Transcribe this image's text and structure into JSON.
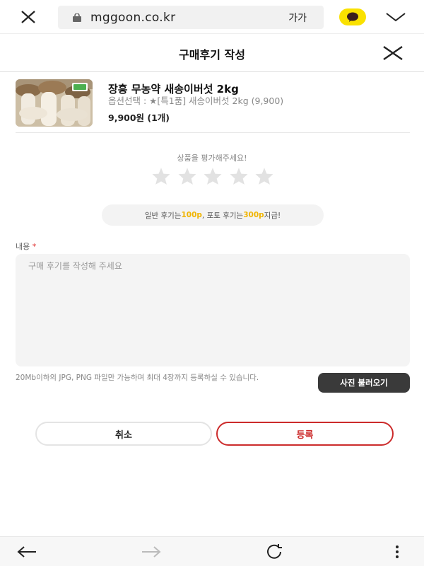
{
  "browser": {
    "url": "mggoon.co.kr",
    "font_size_label": "가가"
  },
  "page": {
    "title": "구매후기 작성"
  },
  "product": {
    "name": "장흥 무농약 새송이버섯 2kg",
    "option": "옵션선택 : ★[특1품] 새송이버섯 2kg (9,900)",
    "price": "9,900원 (1개)"
  },
  "rating": {
    "prompt": "상품을 평가해주세요!",
    "value": 0,
    "max": 5
  },
  "points_notice": {
    "prefix": "일반 후기는 ",
    "normal_points": "100p",
    "middle": ", 포토 후기는 ",
    "photo_points": "300p",
    "suffix": " 지급!"
  },
  "content": {
    "label": "내용",
    "required_mark": "*",
    "placeholder": "구매 후기를 작성해 주세요",
    "value": ""
  },
  "upload": {
    "note": "20Mb이하의 JPG, PNG 파일만 가능하며 최대 4장까지 등록하실 수 있습니다.",
    "button_label": "사진 불러오기"
  },
  "actions": {
    "cancel_label": "취소",
    "submit_label": "등록"
  },
  "icons": {
    "browser_close": "close-icon",
    "lock": "lock-icon",
    "kakao": "kakao-talk-icon",
    "tabs_chevron": "chevron-down-icon",
    "dialog_close": "close-icon",
    "star": "star-icon",
    "back": "arrow-left-icon",
    "forward": "arrow-right-icon",
    "reload": "reload-icon",
    "more": "more-vertical-icon"
  },
  "colors": {
    "accent_red": "#cc2b2b",
    "points_highlight": "#f0b400",
    "kakao_yellow": "#fae100",
    "star_empty": "#e2e2e2"
  }
}
